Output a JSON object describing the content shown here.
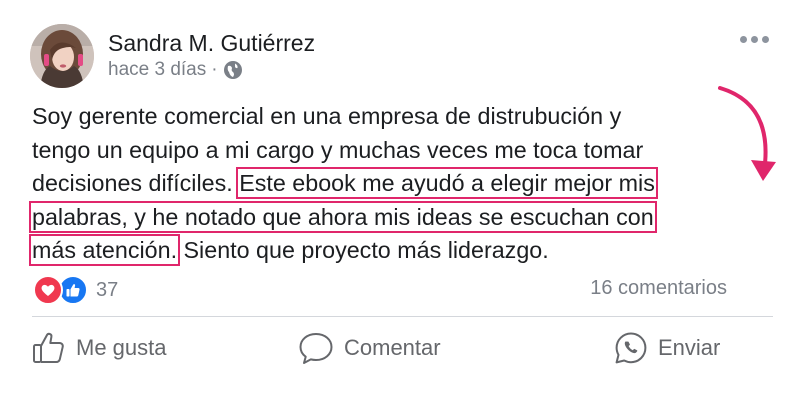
{
  "post": {
    "author": "Sandra M. Gutiérrez",
    "time": "hace 3 días",
    "separator": "·",
    "privacy_icon": "globe-icon",
    "body_lines": [
      "Soy gerente comercial en una empresa de distrubución y",
      "tengo un equipo a mi cargo y muchas veces me toca tomar",
      "decisiones difíciles. ",
      "Este ebook me ayudó a elegir mejor mis",
      "palabras, y he notado que ahora mis ideas se escuchan con",
      "más atención.",
      " Siento que proyecto más liderazgo."
    ],
    "highlight_color": "#e0266b"
  },
  "reactions": {
    "types": [
      "love-icon",
      "like-icon"
    ],
    "count": "37",
    "comments": "16 comentarios"
  },
  "actions": {
    "like_label": "Me gusta",
    "comment_label": "Comentar",
    "share_label": "Enviar"
  },
  "colors": {
    "like_blue": "#1877f2",
    "love_red": "#f0384f",
    "secondary_text": "#65676b"
  }
}
